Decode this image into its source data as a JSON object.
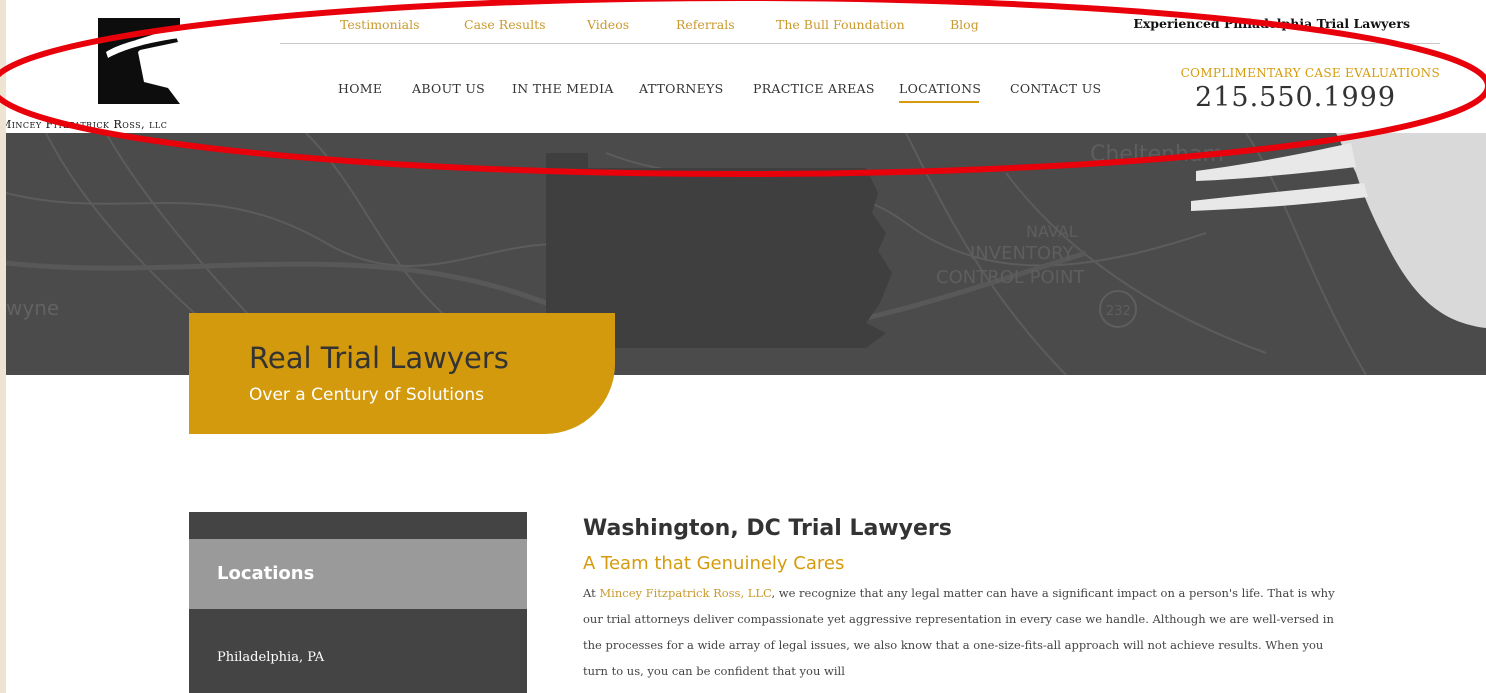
{
  "brand": {
    "name": "Mincey Fitzpatrick Ross, LLC",
    "logo_text": "Mincey Fitzpatrick Ross, llc",
    "accent": "#d59b0c",
    "dark": "#4a4a4a"
  },
  "top_links": [
    "Testimonials",
    "Case Results",
    "Videos",
    "Referrals",
    "The Bull Foundation",
    "Blog"
  ],
  "tagline": "Experienced Philadelphia Trial Lawyers",
  "main_nav": [
    "HOME",
    "ABOUT US",
    "IN THE MEDIA",
    "ATTORNEYS",
    "PRACTICE AREAS",
    "LOCATIONS",
    "CONTACT US"
  ],
  "active_nav": "LOCATIONS",
  "cta": {
    "label": "COMPLIMENTARY CASE EVALUATIONS",
    "phone": "215.550.1999"
  },
  "hero": {
    "title": "Real Trial Lawyers",
    "subtitle": "Over a Century of Solutions",
    "map_labels": [
      "wyne",
      "INVENTORY",
      "CONTROL POINT",
      "NAVAL",
      "Cheltenham",
      "232"
    ]
  },
  "sidebar": {
    "heading": "Locations",
    "items": [
      "Philadelphia, PA"
    ]
  },
  "content": {
    "title": "Washington, DC Trial Lawyers",
    "subtitle": "A Team that Genuinely Cares",
    "para_prefix": "At ",
    "firm_link": "Mincey Fitzpatrick Ross, LLC",
    "para_rest": ", we recognize that any legal matter can have a significant impact on a person's life. That is why our trial attorneys deliver compassionate yet aggressive representation in every case we handle. Although we are well-versed in the processes for a wide array of legal issues, we also know that a one-size-fits-all approach will not achieve results. When you turn to us, you can be confident that you will"
  }
}
